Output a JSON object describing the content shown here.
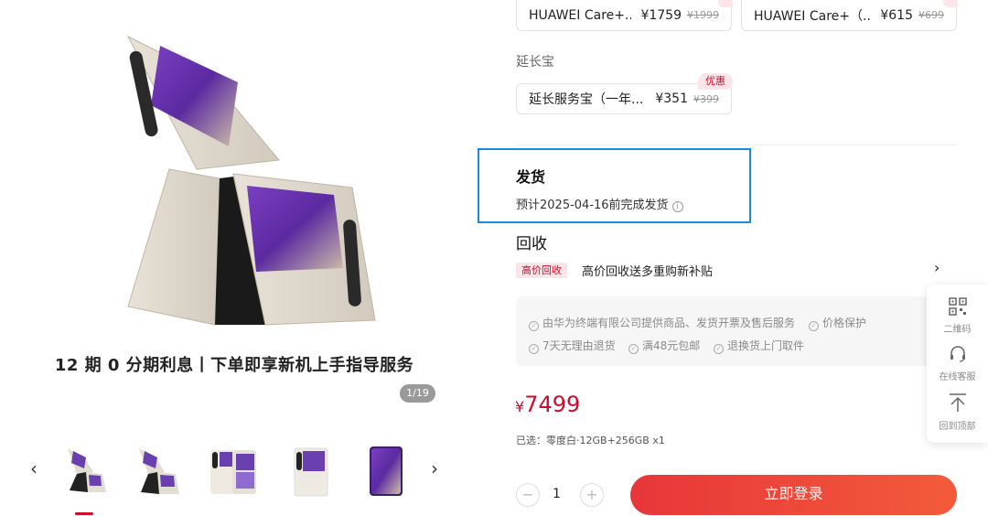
{
  "gallery": {
    "tagline": "12 期 0 分期利息丨下单即享新机上手指导服务",
    "counter": "1/19",
    "prev_arrow": "‹",
    "next_arrow": "›"
  },
  "care_options": [
    {
      "name": "HUAWEI Care+...",
      "price": "¥1759",
      "old": "¥1999"
    },
    {
      "name": "HUAWEI Care+（...",
      "price": "¥615",
      "old": "¥699"
    }
  ],
  "extend": {
    "label": "延长宝",
    "option": {
      "name": "延长服务宝（一年...",
      "price": "¥351",
      "old": "¥399",
      "badge": "优惠"
    }
  },
  "shipping": {
    "title": "发货",
    "text": "预计2025-04-16前完成发货",
    "info_icon": "i"
  },
  "recycle": {
    "title": "回收",
    "badge": "高价回收",
    "text": "高价回收送多重购新补贴",
    "arrow": "›"
  },
  "services": [
    "由华为终端有限公司提供商品、发货开票及售后服务",
    "价格保护",
    "7天无理由退货",
    "满48元包邮",
    "退换货上门取件"
  ],
  "price": {
    "currency": "¥",
    "value": "7499"
  },
  "selected": "已选：零度白·12GB+256GB x1",
  "quantity": {
    "minus": "−",
    "value": "1",
    "plus": "+"
  },
  "buy_button": "立即登录",
  "sidebar": [
    {
      "icon": "qrcode-icon",
      "label": "二维码"
    },
    {
      "icon": "headset-icon",
      "label": "在线客服"
    },
    {
      "icon": "back-to-top-icon",
      "label": "回到顶部"
    }
  ],
  "colors": {
    "brand_red": "#cf0a2c",
    "highlight_blue": "#1e88e5",
    "phone_purple": "#6a3fb0"
  }
}
